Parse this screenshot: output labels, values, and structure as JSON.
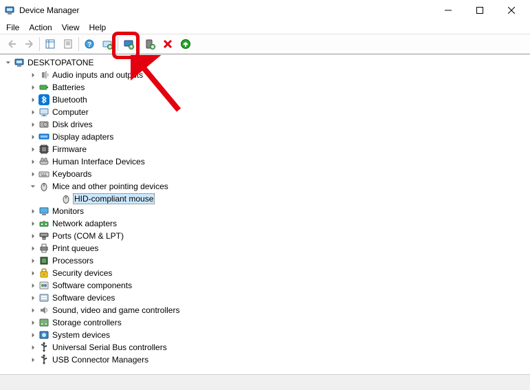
{
  "window": {
    "title": "Device Manager"
  },
  "menu": {
    "items": [
      "File",
      "Action",
      "View",
      "Help"
    ]
  },
  "toolbar": {
    "back": "Back",
    "forward": "Forward",
    "show_hide_tree": "Show/Hide Console Tree",
    "properties": "Properties",
    "help": "Help",
    "scan": "Scan for hardware changes",
    "update_driver": "Update device driver",
    "add_legacy": "Add legacy hardware",
    "uninstall": "Uninstall device",
    "enable": "Enable device"
  },
  "tree": {
    "root": {
      "label": "DESKTOPATONE"
    },
    "categories": [
      {
        "label": "Audio inputs and outputs",
        "icon": "speaker"
      },
      {
        "label": "Batteries",
        "icon": "battery"
      },
      {
        "label": "Bluetooth",
        "icon": "bluetooth"
      },
      {
        "label": "Computer",
        "icon": "monitor"
      },
      {
        "label": "Disk drives",
        "icon": "disk"
      },
      {
        "label": "Display adapters",
        "icon": "display"
      },
      {
        "label": "Firmware",
        "icon": "chip"
      },
      {
        "label": "Human Interface Devices",
        "icon": "hid"
      },
      {
        "label": "Keyboards",
        "icon": "keyboard"
      },
      {
        "label": "Mice and other pointing devices",
        "icon": "mouse",
        "expanded": true,
        "children": [
          {
            "label": "HID-compliant mouse",
            "icon": "mouse",
            "selected": true
          }
        ]
      },
      {
        "label": "Monitors",
        "icon": "monitor2"
      },
      {
        "label": "Network adapters",
        "icon": "network"
      },
      {
        "label": "Ports (COM & LPT)",
        "icon": "port"
      },
      {
        "label": "Print queues",
        "icon": "printer"
      },
      {
        "label": "Processors",
        "icon": "cpu"
      },
      {
        "label": "Security devices",
        "icon": "security"
      },
      {
        "label": "Software components",
        "icon": "swcomp"
      },
      {
        "label": "Software devices",
        "icon": "swdev"
      },
      {
        "label": "Sound, video and game controllers",
        "icon": "sound"
      },
      {
        "label": "Storage controllers",
        "icon": "storage"
      },
      {
        "label": "System devices",
        "icon": "system"
      },
      {
        "label": "Universal Serial Bus controllers",
        "icon": "usb"
      },
      {
        "label": "USB Connector Managers",
        "icon": "usb"
      }
    ]
  }
}
